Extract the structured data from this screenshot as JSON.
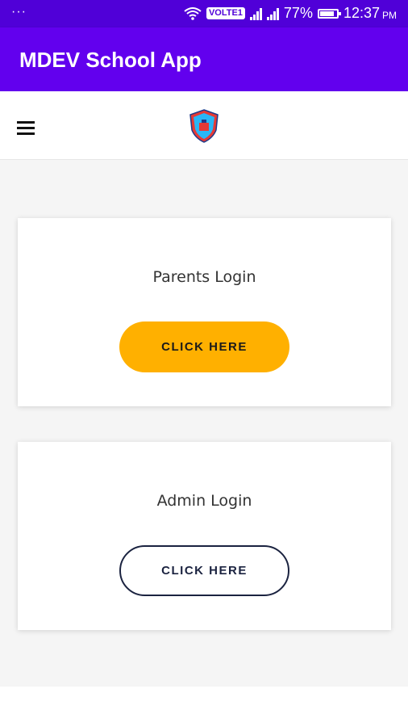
{
  "status_bar": {
    "notification_dots": "···",
    "network_label": "VOLTE1",
    "battery_percent": "77%",
    "battery_level": 0.77,
    "time": "12:37",
    "am_pm": "PM"
  },
  "app_bar": {
    "title": "MDEV School App"
  },
  "nav": {
    "menu_icon": "hamburger-icon",
    "logo_icon": "school-crest-logo"
  },
  "cards": [
    {
      "label": "Parents Login",
      "button_label": "CLICK HERE",
      "button_color": "#ffb000"
    },
    {
      "label": "Admin Login",
      "button_label": "CLICK HERE",
      "button_color": "#ffffff"
    }
  ],
  "colors": {
    "status_bar": "#5000d8",
    "app_bar": "#6200ee",
    "accent": "#ffb000",
    "outline": "#1b2340"
  }
}
